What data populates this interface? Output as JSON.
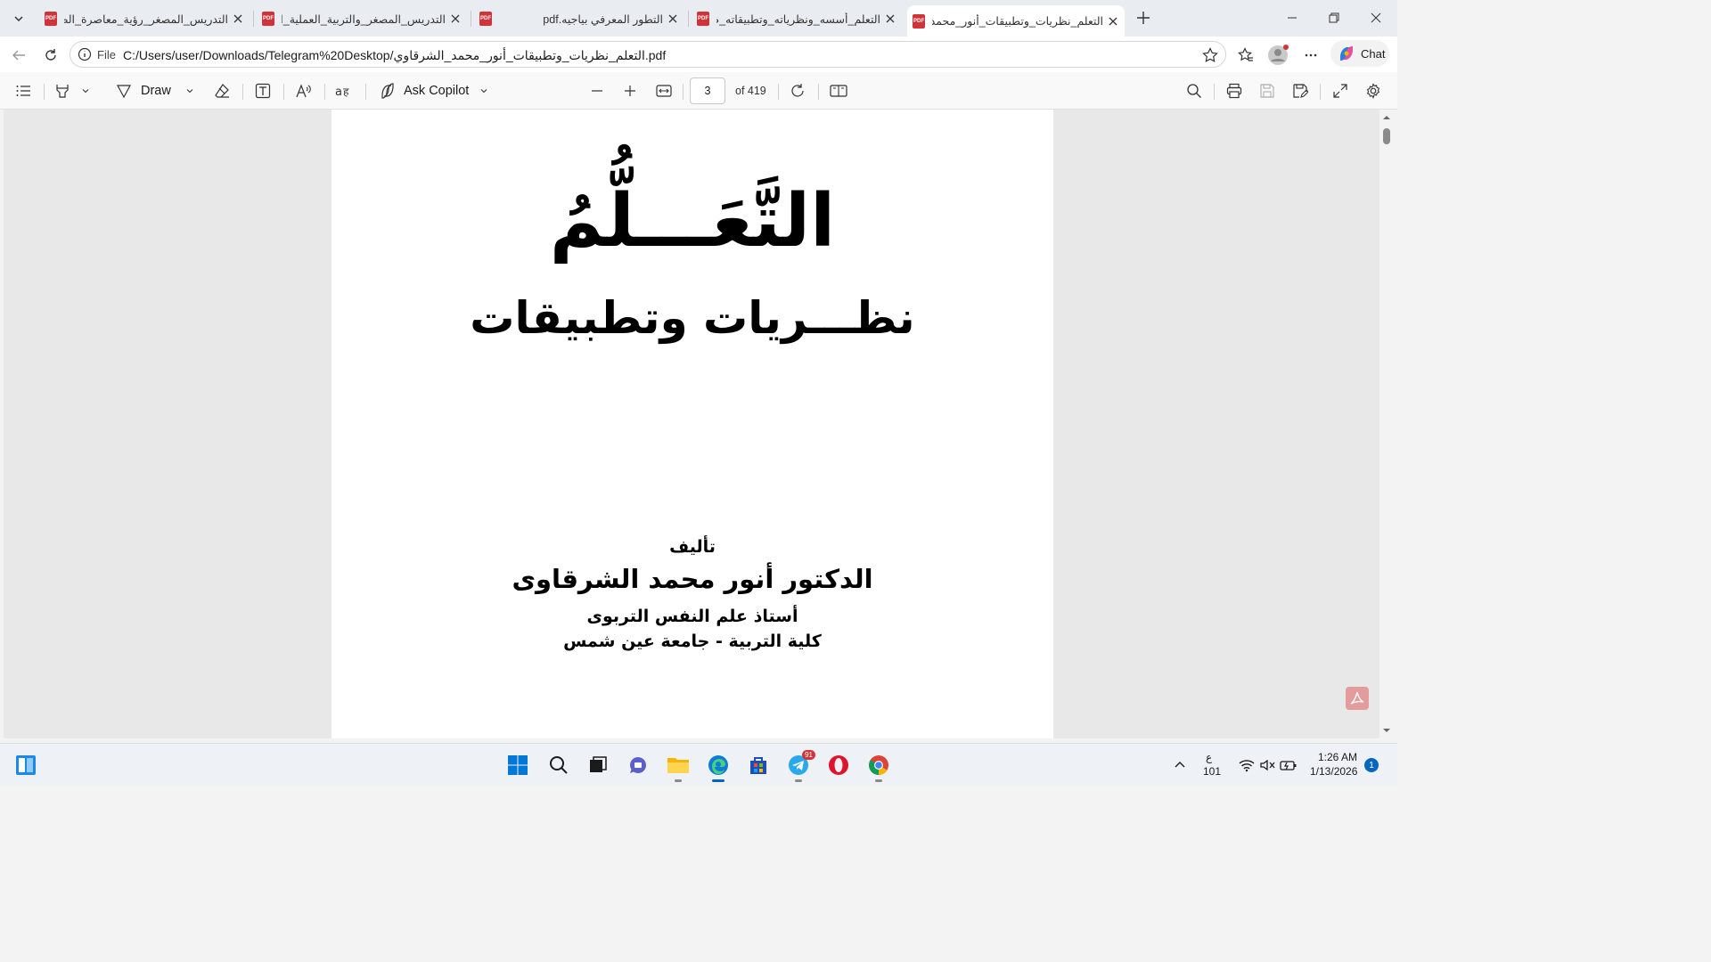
{
  "tabs": [
    {
      "title": "التدريس_المصغر_رؤية_معاصرة_الصا",
      "active": false
    },
    {
      "title": "التدريس_المصغر_والتربية_العملية_ال",
      "active": false
    },
    {
      "title": "التطور المعرفي بياجيه.pdf",
      "active": false
    },
    {
      "title": "التعلم_أسسه_ونظرياته_وتطبيقاته_ط",
      "active": false
    },
    {
      "title": "التعلم_نظريات_وتطبيقات_أنور_محمد",
      "active": true
    }
  ],
  "address_bar": {
    "scheme_label": "File",
    "url": "C:/Users/user/Downloads/Telegram%20Desktop/التعلم_نظريات_وتطبيقات_أنور_محمد_الشرقاوي.pdf"
  },
  "chat_label": "Chat",
  "pdf_toolbar": {
    "draw_label": "Draw",
    "copilot_label": "Ask Copilot",
    "page_number": "3",
    "page_count": "of 419"
  },
  "document": {
    "main_title": "التَّعَـــلُّمُ",
    "subtitle": "نظـــريات وتطبيقات",
    "by_label": "تأليف",
    "author": "الدكتور أنور محمد الشرقاوى",
    "position": "أستاذ علم النفس التربوى",
    "institution": "كلية التربية - جامعة عين شمس"
  },
  "taskbar": {
    "telegram_badge": "91",
    "keyboard_lang": "ع",
    "keyboard_sub": "101",
    "time": "1:26 AM",
    "date": "1/13/2026",
    "notification_count": "1"
  },
  "colors": {
    "accent": "#0067c0",
    "pdf_red": "#d13438",
    "viewer_bg": "#e8e8e8"
  },
  "icons": [
    "tab-actions-icon",
    "pdf-file-icon",
    "close-icon",
    "new-tab-icon",
    "minimize-icon",
    "restore-icon",
    "window-close-icon",
    "back-icon",
    "refresh-icon",
    "info-icon",
    "favorite-star-icon",
    "favorites-icon",
    "profile-icon",
    "more-icon",
    "copilot-icon",
    "contents-icon",
    "highlight-icon",
    "draw-icon",
    "erase-icon",
    "text-icon",
    "read-aloud-icon",
    "translate-icon",
    "zoom-out-icon",
    "zoom-in-icon",
    "fit-width-icon",
    "rotate-icon",
    "page-view-icon",
    "search-icon",
    "print-icon",
    "save-icon",
    "save-as-icon",
    "fullscreen-icon",
    "settings-icon",
    "windows-start-icon",
    "taskbar-search-icon",
    "task-view-icon",
    "teams-icon",
    "file-explorer-icon",
    "edge-icon",
    "store-icon",
    "telegram-icon",
    "opera-icon",
    "chrome-icon",
    "tray-chevron-icon",
    "wifi-icon",
    "volume-muted-icon",
    "battery-icon"
  ]
}
